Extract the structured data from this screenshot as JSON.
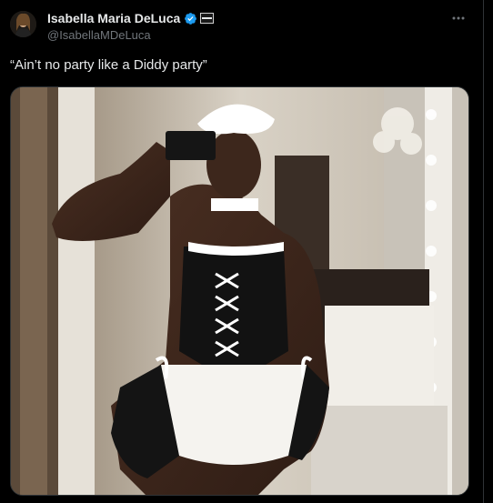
{
  "author": {
    "display_name": "Isabella Maria DeLuca",
    "handle": "@IsabellaMDeLuca",
    "verified": true,
    "badge_icon": "flag-icon"
  },
  "post": {
    "text": "“Ain’t no party like a Diddy party”",
    "media": {
      "kind": "photo",
      "description": "mirror selfie photo"
    }
  },
  "colors": {
    "background": "#000000",
    "text_primary": "#e7e9ea",
    "text_secondary": "#71767b",
    "verified_blue": "#1d9bf0",
    "border": "#2f3336"
  }
}
